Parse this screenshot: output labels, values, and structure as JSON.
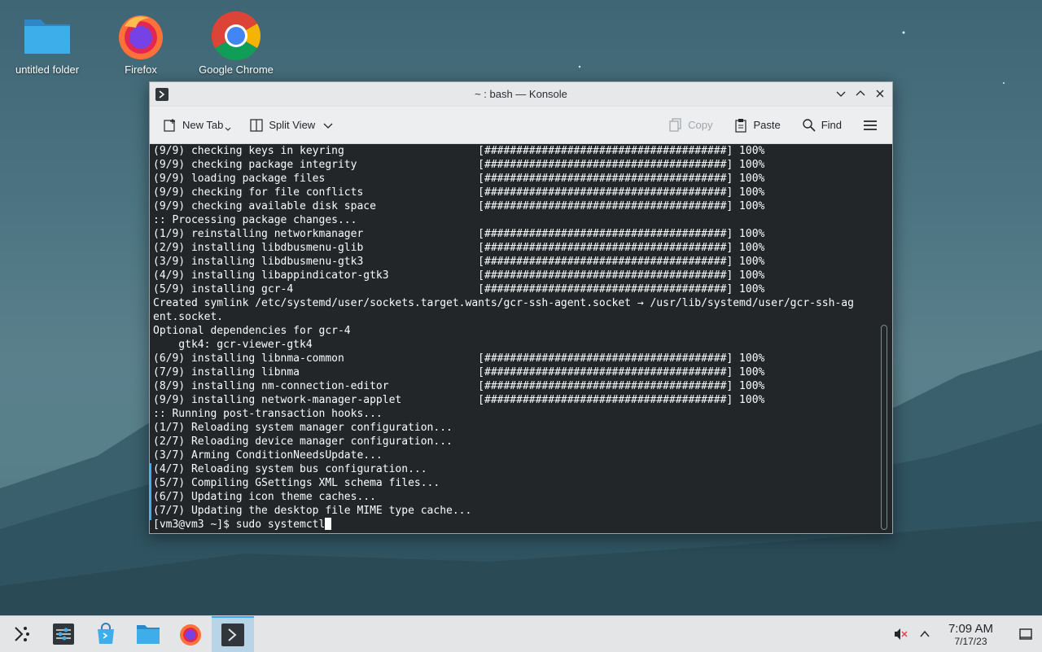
{
  "desktop": {
    "icons": [
      {
        "label": "untitled folder"
      },
      {
        "label": "Firefox"
      },
      {
        "label": "Google Chrome"
      }
    ]
  },
  "window": {
    "title": "~ : bash — Konsole",
    "toolbar": {
      "new_tab": "New Tab",
      "split_view": "Split View",
      "copy": "Copy",
      "paste": "Paste",
      "find": "Find"
    }
  },
  "terminal": {
    "lines": [
      "(9/9) checking keys in keyring                     [######################################] 100%",
      "(9/9) checking package integrity                   [######################################] 100%",
      "(9/9) loading package files                        [######################################] 100%",
      "(9/9) checking for file conflicts                  [######################################] 100%",
      "(9/9) checking available disk space                [######################################] 100%",
      ":: Processing package changes...",
      "(1/9) reinstalling networkmanager                  [######################################] 100%",
      "(2/9) installing libdbusmenu-glib                  [######################################] 100%",
      "(3/9) installing libdbusmenu-gtk3                  [######################################] 100%",
      "(4/9) installing libappindicator-gtk3              [######################################] 100%",
      "(5/9) installing gcr-4                             [######################################] 100%",
      "Created symlink /etc/systemd/user/sockets.target.wants/gcr-ssh-agent.socket → /usr/lib/systemd/user/gcr-ssh-ag",
      "ent.socket.",
      "Optional dependencies for gcr-4",
      "    gtk4: gcr-viewer-gtk4",
      "(6/9) installing libnma-common                     [######################################] 100%",
      "(7/9) installing libnma                            [######################################] 100%",
      "(8/9) installing nm-connection-editor              [######################################] 100%",
      "(9/9) installing network-manager-applet            [######################################] 100%",
      ":: Running post-transaction hooks...",
      "(1/7) Reloading system manager configuration...",
      "(2/7) Reloading device manager configuration...",
      "(3/7) Arming ConditionNeedsUpdate...",
      "(4/7) Reloading system bus configuration...",
      "(5/7) Compiling GSettings XML schema files...",
      "(6/7) Updating icon theme caches...",
      "(7/7) Updating the desktop file MIME type cache..."
    ],
    "prompt": "[vm3@vm3 ~]$ sudo systemctl"
  },
  "taskbar": {
    "time": "7:09 AM",
    "date": "7/17/23"
  }
}
